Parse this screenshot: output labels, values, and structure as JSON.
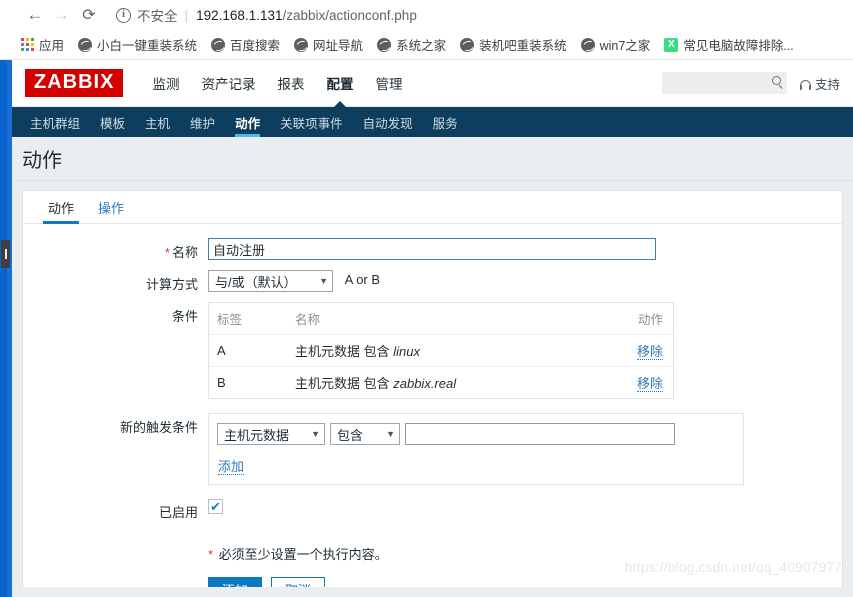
{
  "browser": {
    "back_icon": "back-arrow-icon",
    "forward_icon": "forward-arrow-icon",
    "reload_icon": "reload-icon",
    "info_icon": "info-circle-icon",
    "security_label": "不安全",
    "separator": "|",
    "url_host": "192.168.1.131",
    "url_path": "/zabbix/actionconf.php",
    "url_full": "192.168.1.131/zabbix/actionconf.php"
  },
  "bookmarks": {
    "apps_label": "应用",
    "apps_icon": "apps-grid-icon",
    "apps_colors": [
      "#ea4335",
      "#fbbc05",
      "#34a853",
      "#4285f4",
      "#ea4335",
      "#fbbc05",
      "#34a853",
      "#4285f4",
      "#ea4335"
    ],
    "items": [
      {
        "label": "小白一键重装系统",
        "icon": "globe-icon"
      },
      {
        "label": "百度搜索",
        "icon": "globe-icon"
      },
      {
        "label": "网址导航",
        "icon": "globe-icon"
      },
      {
        "label": "系统之家",
        "icon": "globe-icon"
      },
      {
        "label": "装机吧重装系统",
        "icon": "globe-icon"
      },
      {
        "label": "win7之家",
        "icon": "globe-icon"
      },
      {
        "label": "常见电脑故障排除...",
        "icon": "spreadsheet-icon",
        "icon_glyph": "X"
      }
    ]
  },
  "app": {
    "logo_text": "ZABBIX",
    "logo_color": "#d40000",
    "main_menu": [
      {
        "label": "监测",
        "active": false
      },
      {
        "label": "资产记录",
        "active": false
      },
      {
        "label": "报表",
        "active": false
      },
      {
        "label": "配置",
        "active": true
      },
      {
        "label": "管理",
        "active": false
      }
    ],
    "search": {
      "value": "",
      "placeholder": "",
      "icon": "search-icon"
    },
    "support": {
      "label": "支持",
      "icon": "headset-icon"
    },
    "sub_menu": [
      {
        "label": "主机群组",
        "active": false
      },
      {
        "label": "模板",
        "active": false
      },
      {
        "label": "主机",
        "active": false
      },
      {
        "label": "维护",
        "active": false
      },
      {
        "label": "动作",
        "active": true
      },
      {
        "label": "关联项事件",
        "active": false
      },
      {
        "label": "自动发现",
        "active": false
      },
      {
        "label": "服务",
        "active": false
      }
    ],
    "accent_color": "#0c7ac0",
    "subnav_bg": "#0e3e5d",
    "subnav_active_underline": "#51b6e8"
  },
  "page": {
    "title": "动作",
    "tabs": [
      {
        "label": "动作",
        "active": true
      },
      {
        "label": "操作",
        "active": false
      }
    ]
  },
  "form": {
    "name_row": {
      "label": "名称",
      "required_marker": "*",
      "value": "自动注册",
      "placeholder": ""
    },
    "calc_row": {
      "label": "计算方式",
      "select_value": "与/或（默认）",
      "caret": "▼",
      "expression": "A or B"
    },
    "conditions_row": {
      "label": "条件",
      "columns": [
        "标签",
        "名称",
        "动作"
      ],
      "rows": [
        {
          "tag": "A",
          "name_prefix": "主机元数据 包含 ",
          "name_value": "linux",
          "action": "移除"
        },
        {
          "tag": "B",
          "name_prefix": "主机元数据 包含 ",
          "name_value": "zabbix.real",
          "action": "移除"
        }
      ]
    },
    "new_condition_row": {
      "label": "新的触发条件",
      "type_value": "主机元数据",
      "operator_value": "包含",
      "caret": "▼",
      "value": "",
      "placeholder": "",
      "add_link": "添加"
    },
    "enabled_row": {
      "label": "已启用",
      "checked": true,
      "check_glyph": "✔"
    },
    "hint": {
      "required_marker": "*",
      "text": " 必须至少设置一个执行内容。"
    },
    "buttons": {
      "submit": "添加",
      "cancel": "取消"
    }
  },
  "watermark": "https://blog.csdn.net/qq_40907977"
}
